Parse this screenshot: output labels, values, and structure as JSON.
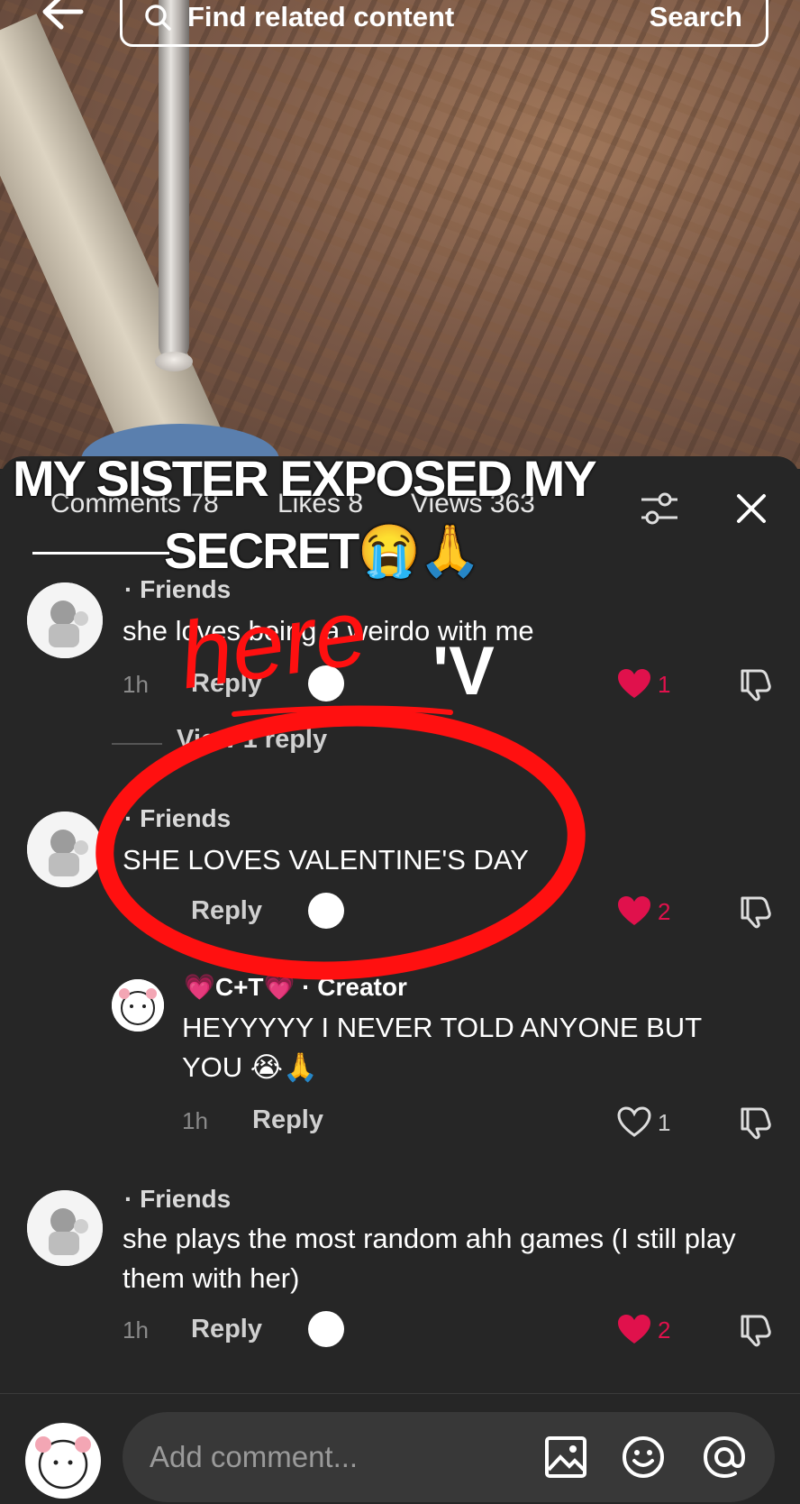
{
  "search": {
    "placeholder": "Find related content",
    "button": "Search"
  },
  "header": {
    "comments": "Comments 78",
    "likes": "Likes 8",
    "views": "Views 363"
  },
  "overlay": {
    "line1": "MY SISTER EXPOSED MY",
    "line2": "SECRET😭🙏",
    "annotation": "here",
    "arrow": "'V"
  },
  "comments": [
    {
      "name": "· Friends",
      "text": "she loves being a weirdo with me",
      "time": "1h",
      "reply": "Reply",
      "likes": "1",
      "liked": true
    },
    {
      "name": "· Friends",
      "text": "SHE LOVES VALENTINE'S DAY",
      "time": "",
      "reply": "Reply",
      "likes": "2",
      "liked": true
    },
    {
      "name": "· Friends",
      "text": "she plays the most random ahh games (I still play them with her)",
      "time": "1h",
      "reply": "Reply",
      "likes": "2",
      "liked": true
    }
  ],
  "view_replies": "View 1 reply",
  "creator_reply": {
    "name": "💗C+T💗 · Creator",
    "text": "HEYYYYY I NEVER TOLD ANYONE BUT YOU 😭🙏",
    "time": "1h",
    "reply": "Reply",
    "likes": "1",
    "liked": false
  },
  "bottom": {
    "placeholder": "Add comment..."
  },
  "colors": {
    "heart": "#e0114c",
    "background": "#262626",
    "annotation_red": "#ff1010"
  }
}
